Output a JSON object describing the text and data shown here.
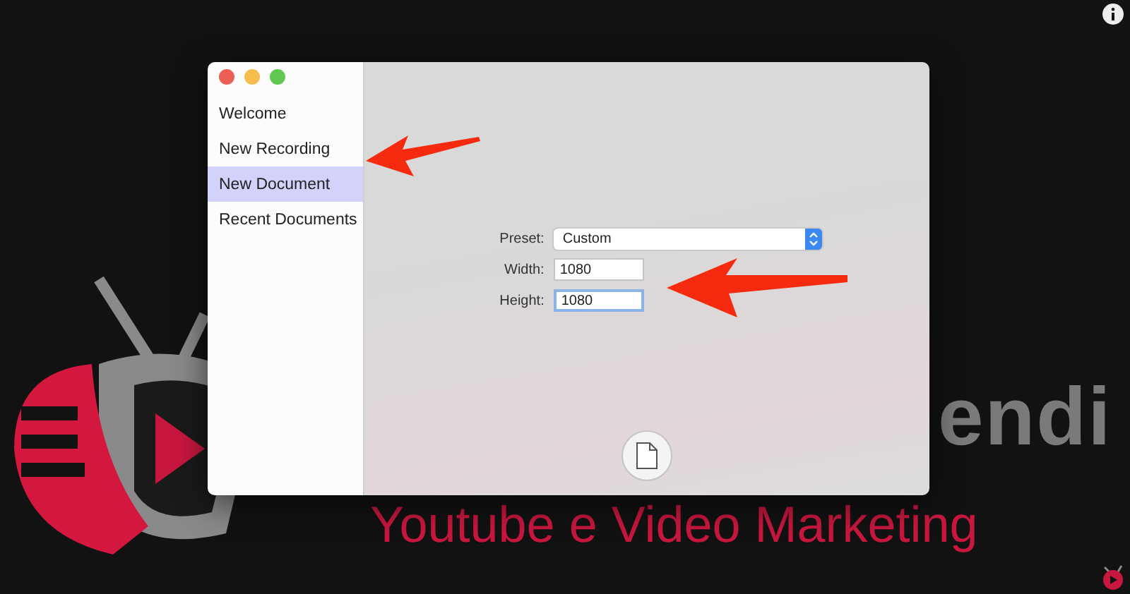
{
  "background": {
    "wordmark": "endi",
    "tagline": "Youtube e Video Marketing"
  },
  "window": {
    "controls": [
      {
        "kind": "close"
      },
      {
        "kind": "minimize"
      },
      {
        "kind": "zoom"
      }
    ]
  },
  "sidebar": {
    "items": [
      {
        "label": "Welcome",
        "selected": false
      },
      {
        "label": "New Recording",
        "selected": false
      },
      {
        "label": "New Document",
        "selected": true
      },
      {
        "label": "Recent Documents",
        "selected": false
      }
    ]
  },
  "form": {
    "rows": [
      {
        "kind": "popup",
        "label": "Preset:",
        "value": "Custom"
      },
      {
        "kind": "text",
        "label": "Width:",
        "value": "1080",
        "focused": false
      },
      {
        "kind": "text",
        "label": "Height:",
        "value": "1080",
        "focused": true
      }
    ]
  }
}
